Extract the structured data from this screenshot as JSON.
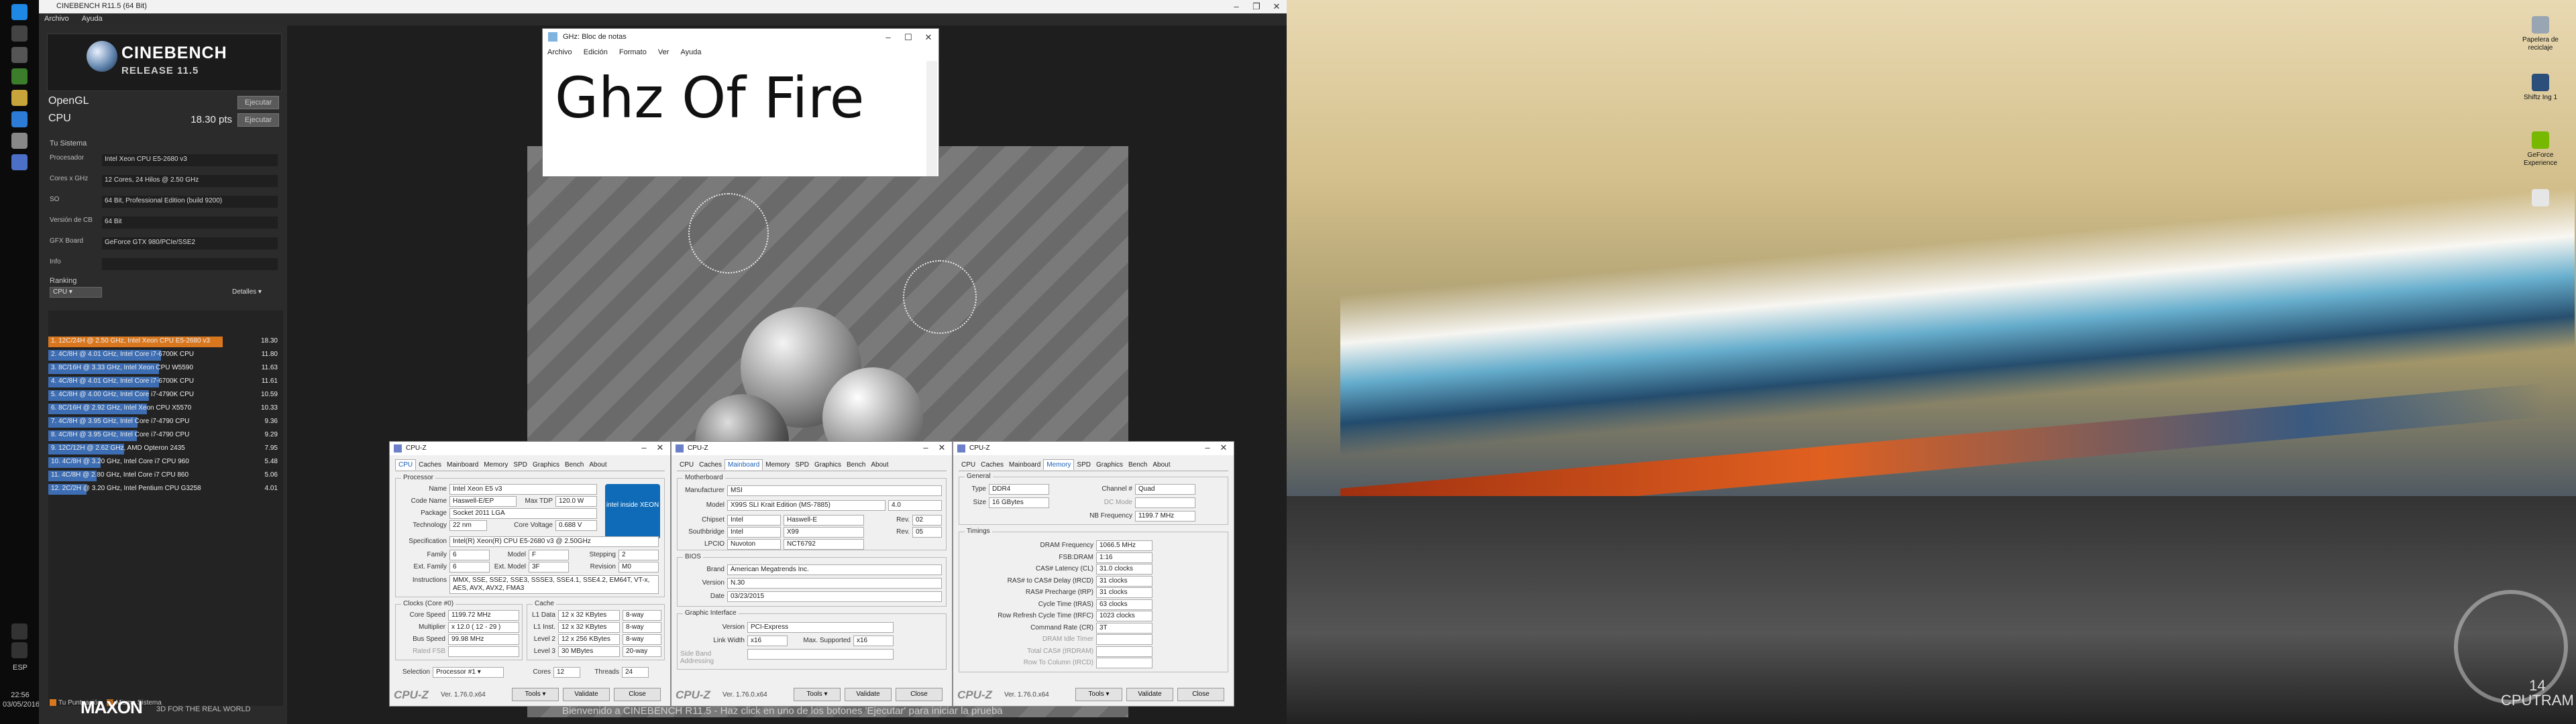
{
  "taskbar": {
    "language": "ESP",
    "time": "22:56",
    "date": "03/05/2016"
  },
  "cinebench": {
    "window_title": "CINEBENCH R11.5 (64 Bit)",
    "menu": [
      "Archivo",
      "Ayuda"
    ],
    "logo_name": "CINEBENCH",
    "logo_release": "RELEASE 11.5",
    "opengl_label": "OpenGL",
    "opengl_value": "",
    "cpu_label": "CPU",
    "cpu_value": "18.30 pts",
    "run_button": "Ejecutar",
    "system_title": "Tu Sistema",
    "system": [
      {
        "label": "Procesador",
        "value": "Intel Xeon CPU E5-2680 v3"
      },
      {
        "label": "Cores x GHz",
        "value": "12 Cores, 24 Hilos @ 2.50 GHz"
      },
      {
        "label": "SO",
        "value": "64 Bit, Professional Edition (build 9200)"
      },
      {
        "label": "Versión de CB",
        "value": "64 Bit"
      },
      {
        "label": "GFX Board",
        "value": "GeForce GTX 980/PCIe/SSE2"
      },
      {
        "label": "Info",
        "value": ""
      }
    ],
    "ranking_title": "Ranking",
    "ranking_filter": "CPU",
    "details_label": "Detalles",
    "ranking": [
      {
        "text": "1. 12C/24H @ 2.50 GHz, Intel Xeon CPU E5-2680 v3",
        "score": "18.30",
        "kind": "mine"
      },
      {
        "text": "2. 4C/8H @ 4.01 GHz, Intel Core i7-6700K CPU",
        "score": "11.80",
        "kind": "ref"
      },
      {
        "text": "3. 8C/16H @ 3.33 GHz, Intel Xeon CPU W5590",
        "score": "11.63",
        "kind": "ref"
      },
      {
        "text": "4. 4C/8H @ 4.01 GHz, Intel Core i7-6700K CPU",
        "score": "11.61",
        "kind": "ref"
      },
      {
        "text": "5. 4C/8H @ 4.00 GHz, Intel Core i7-4790K CPU",
        "score": "10.59",
        "kind": "ref"
      },
      {
        "text": "6. 8C/16H @ 2.92 GHz, Intel Xeon CPU X5570",
        "score": "10.33",
        "kind": "ref"
      },
      {
        "text": "7. 4C/8H @ 3.95 GHz, Intel Core i7-4790 CPU",
        "score": "9.36",
        "kind": "ref"
      },
      {
        "text": "8. 4C/8H @ 3.95 GHz, Intel Core i7-4790 CPU",
        "score": "9.29",
        "kind": "ref"
      },
      {
        "text": "9. 12C/12H @ 2.62 GHz, AMD Opteron 2435",
        "score": "7.95",
        "kind": "ref"
      },
      {
        "text": "10. 4C/8H @ 3.20 GHz, Intel Core i7 CPU 960",
        "score": "5.48",
        "kind": "ref"
      },
      {
        "text": "11. 4C/8H @ 2.80 GHz, Intel Core i7 CPU 860",
        "score": "5.06",
        "kind": "ref"
      },
      {
        "text": "12. 2C/2H @ 3.20 GHz, Intel Pentium CPU G3258",
        "score": "4.01",
        "kind": "ref"
      }
    ],
    "legend_mine": "Tu Puntuación",
    "legend_same": "Mismo Sistema",
    "brand": "MAXON",
    "brand_tag": "3D FOR THE REAL WORLD",
    "status": "Bienvenido a CINEBENCH R11.5 - Haz click en uno de los botones 'Ejecutar' para iniciar la prueba"
  },
  "notepad": {
    "title": "GHz: Bloc de notas",
    "menu": [
      "Archivo",
      "Edición",
      "Formato",
      "Ver",
      "Ayuda"
    ],
    "text": "Ghz Of Fire"
  },
  "cpuz_common": {
    "title": "CPU-Z",
    "tabs": [
      "CPU",
      "Caches",
      "Mainboard",
      "Memory",
      "SPD",
      "Graphics",
      "Bench",
      "About"
    ],
    "brand": "CPU-Z",
    "version": "Ver. 1.76.0.x64",
    "tools": "Tools",
    "validate": "Validate",
    "close": "Close"
  },
  "cpuz_cpu": {
    "group_processor": "Processor",
    "name": "Intel Xeon E5 v3",
    "code_name": "Haswell-E/EP",
    "max_tdp": "120.0 W",
    "package": "Socket 2011 LGA",
    "technology": "22 nm",
    "core_voltage": "0.688 V",
    "specification": "Intel(R) Xeon(R) CPU E5-2680 v3 @ 2.50GHz",
    "family": "6",
    "model": "F",
    "stepping": "2",
    "ext_family": "6",
    "ext_model": "3F",
    "revision": "M0",
    "instructions": "MMX, SSE, SSE2, SSE3, SSSE3, SSE4.1, SSE4.2, EM64T, VT-x, AES, AVX, AVX2, FMA3",
    "group_clocks": "Clocks (Core #0)",
    "core_speed": "1199.72 MHz",
    "multiplier": "x 12.0 ( 12 - 29 )",
    "bus_speed": "99.98 MHz",
    "rated_fsb": "",
    "group_cache": "Cache",
    "l1_data": "12 x 32 KBytes",
    "l1_data_way": "8-way",
    "l1_inst": "12 x 32 KBytes",
    "l1_inst_way": "8-way",
    "level2": "12 x 256 KBytes",
    "level2_way": "8-way",
    "level3": "30 MBytes",
    "level3_way": "20-way",
    "selection": "Processor #1",
    "cores": "12",
    "threads": "24",
    "intel_badge": "intel inside XEON",
    "labels": {
      "name": "Name",
      "code_name": "Code Name",
      "max_tdp": "Max TDP",
      "package": "Package",
      "technology": "Technology",
      "core_voltage": "Core Voltage",
      "specification": "Specification",
      "family": "Family",
      "model": "Model",
      "stepping": "Stepping",
      "ext_family": "Ext. Family",
      "ext_model": "Ext. Model",
      "revision": "Revision",
      "instructions": "Instructions",
      "core_speed": "Core Speed",
      "multiplier": "Multiplier",
      "bus_speed": "Bus Speed",
      "rated_fsb": "Rated FSB",
      "l1_data": "L1 Data",
      "l1_inst": "L1 Inst.",
      "level2": "Level 2",
      "level3": "Level 3",
      "selection": "Selection",
      "cores": "Cores",
      "threads": "Threads"
    }
  },
  "cpuz_mb": {
    "group_motherboard": "Motherboard",
    "manufacturer": "MSI",
    "model": "X99S SLI Krait Edition (MS-7885)",
    "model_rev": "4.0",
    "chipset": "Intel",
    "chipset_model": "Haswell-E",
    "chipset_rev": "02",
    "southbridge": "Intel",
    "southbridge_model": "X99",
    "southbridge_rev": "05",
    "lpcio": "Nuvoton",
    "lpcio_model": "NCT6792",
    "group_bios": "BIOS",
    "bios_brand": "American Megatrends Inc.",
    "bios_version": "N.30",
    "bios_date": "03/23/2015",
    "group_graphic": "Graphic Interface",
    "gi_version": "PCI-Express",
    "link_width": "x16",
    "max_supported": "x16",
    "side_band": "",
    "labels": {
      "manufacturer": "Manufacturer",
      "model": "Model",
      "chipset": "Chipset",
      "southbridge": "Southbridge",
      "lpcio": "LPCIO",
      "rev": "Rev.",
      "brand": "Brand",
      "version": "Version",
      "date": "Date",
      "gi_version": "Version",
      "link_width": "Link Width",
      "max_supported": "Max. Supported",
      "side_band": "Side Band Addressing"
    }
  },
  "cpuz_mem": {
    "group_general": "General",
    "type": "DDR4",
    "channel": "Quad",
    "size": "16 GBytes",
    "dc_mode": "",
    "nb_frequency": "1199.7 MHz",
    "group_timings": "Timings",
    "dram_frequency": "1066.5 MHz",
    "fsb_dram": "1:16",
    "cas_latency": "31.0 clocks",
    "ras_to_cas": "31 clocks",
    "ras_precharge": "31 clocks",
    "cycle_time": "63 clocks",
    "row_refresh": "1023 clocks",
    "command_rate": "3T",
    "labels": {
      "type": "Type",
      "channel": "Channel #",
      "size": "Size",
      "dc_mode": "DC Mode",
      "nb_frequency": "NB Frequency",
      "dram_frequency": "DRAM Frequency",
      "fsb_dram": "FSB:DRAM",
      "cas_latency": "CAS# Latency (CL)",
      "ras_to_cas": "RAS# to CAS# Delay (tRCD)",
      "ras_precharge": "RAS# Precharge (tRP)",
      "cycle_time": "Cycle Time (tRAS)",
      "row_refresh": "Row Refresh Cycle Time (tRFC)",
      "command_rate": "Command Rate (CR)",
      "dram_idle": "DRAM Idle Timer",
      "total_cas": "Total CAS# (tRDRAM)",
      "row_to_column": "Row To Column (tRCD)"
    }
  },
  "desktop_icons": [
    {
      "label": "Papelera de reciclaje",
      "color": "#9aa5b4"
    },
    {
      "label": "Shiftz Ing 1",
      "color": "#2b4e7a"
    },
    {
      "label": "GeForce Experience",
      "color": "#76b900"
    },
    {
      "label": "",
      "color": "#e6e6e6"
    }
  ],
  "watermark": {
    "line1": "14",
    "line2": "CPUTRAM"
  },
  "colors": {
    "accent_orange": "#d9771f",
    "rank_blue": "#3d6db2",
    "cpuz_tab_active": "#1a5fb4"
  }
}
